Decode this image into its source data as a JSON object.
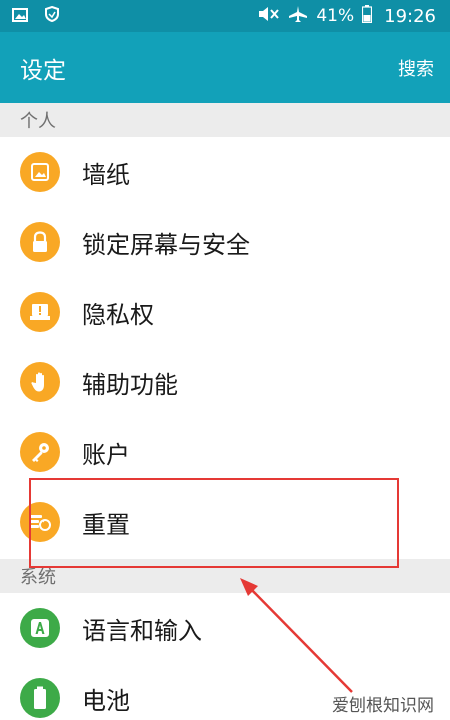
{
  "status_bar": {
    "battery": "41%",
    "time": "19:26",
    "icons": [
      "image-icon",
      "shield-icon",
      "mute-icon",
      "airplane-icon",
      "battery-icon"
    ]
  },
  "app_bar": {
    "title": "设定",
    "action": "搜索"
  },
  "sections": [
    {
      "header": "个人",
      "items": [
        {
          "label": "墙纸",
          "icon": "wallpaper-icon",
          "color": "#f9a825"
        },
        {
          "label": "锁定屏幕与安全",
          "icon": "lock-icon",
          "color": "#f9a825"
        },
        {
          "label": "隐私权",
          "icon": "privacy-icon",
          "color": "#f9a825"
        },
        {
          "label": "辅助功能",
          "icon": "hand-icon",
          "color": "#f9a825"
        },
        {
          "label": "账户",
          "icon": "key-icon",
          "color": "#f9a825"
        },
        {
          "label": "重置",
          "icon": "reset-icon",
          "color": "#f9a825"
        }
      ]
    },
    {
      "header": "系统",
      "items": [
        {
          "label": "语言和输入",
          "icon": "language-icon",
          "color": "#3daa48"
        },
        {
          "label": "电池",
          "icon": "battery-icon",
          "color": "#3daa48"
        }
      ]
    }
  ],
  "watermark": "爱刨根知识网"
}
